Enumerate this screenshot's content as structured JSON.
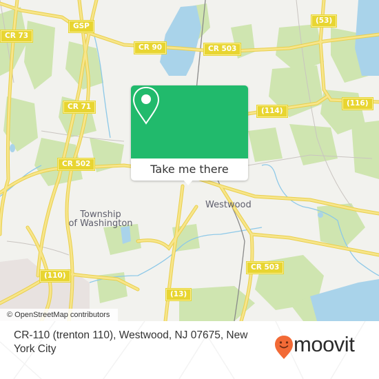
{
  "map": {
    "attribution": "© OpenStreetMap contributors",
    "colors": {
      "land": "#f2f2ee",
      "park": "#cfe5b0",
      "water": "#a9d3ea",
      "road": "#f4df6a",
      "road_edge": "#e9cf4b",
      "rail": "#8a8a8a",
      "urban": "#e8e2e0"
    },
    "road_labels": [
      {
        "id": "gsp",
        "text": "GSP"
      },
      {
        "id": "cr73",
        "text": "CR 73"
      },
      {
        "id": "cr90",
        "text": "CR 90"
      },
      {
        "id": "cr503-north",
        "text": "CR 503"
      },
      {
        "id": "r53",
        "text": "(53)"
      },
      {
        "id": "cr71",
        "text": "CR 71"
      },
      {
        "id": "r114",
        "text": "(114)"
      },
      {
        "id": "r116",
        "text": "(116)"
      },
      {
        "id": "cr502",
        "text": "CR 502"
      },
      {
        "id": "cr503-south",
        "text": "CR 503"
      },
      {
        "id": "r110",
        "text": "(110)"
      },
      {
        "id": "r13",
        "text": "(13)"
      }
    ],
    "place_labels": [
      {
        "id": "westwood",
        "text": "Westwood"
      },
      {
        "id": "township",
        "line1": "Township",
        "line2": "of Washington"
      }
    ]
  },
  "popup": {
    "icon": "map-pin-icon",
    "button_label": "Take me there",
    "accent": "#21ba6c"
  },
  "footer": {
    "address": "CR-110 (trenton 110), Westwood, NJ 07675, New York City",
    "brand": "moovit",
    "brand_icon": "moovit-smiley-pin-icon",
    "brand_color": "#f26a36"
  }
}
